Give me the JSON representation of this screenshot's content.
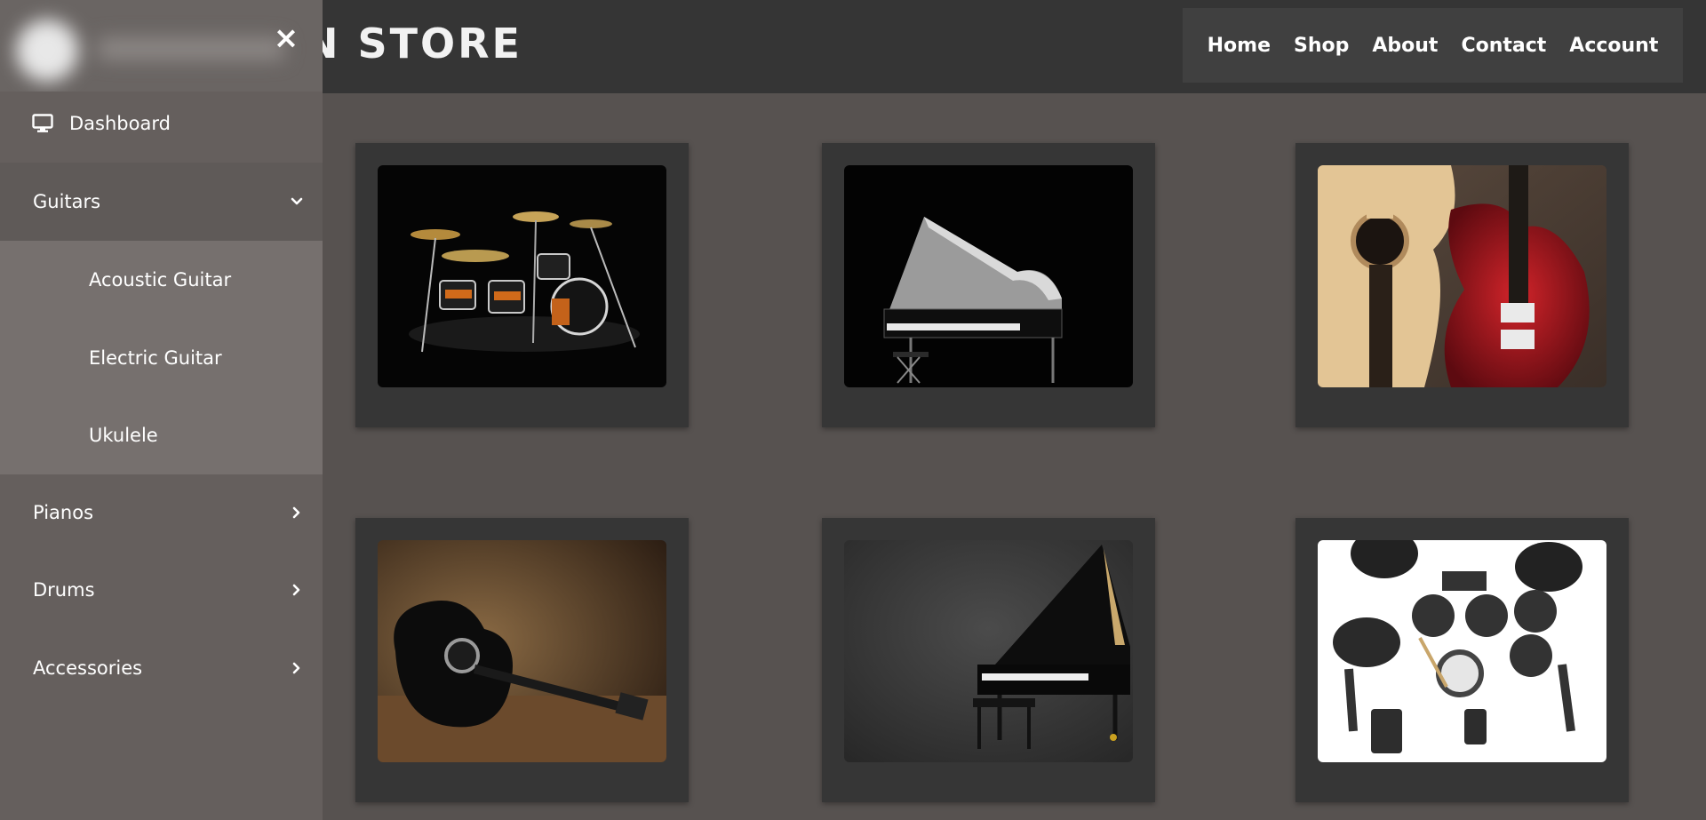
{
  "header": {
    "brand": "N STORE",
    "nav": [
      "Home",
      "Shop",
      "About",
      "Contact",
      "Account"
    ]
  },
  "sidebar": {
    "close_label": "×",
    "items": [
      {
        "label": "Dashboard",
        "icon": "monitor-icon"
      },
      {
        "label": "Guitars",
        "icon": "chevron-down-icon",
        "expanded": true
      },
      {
        "label": "Pianos",
        "icon": "chevron-right-icon"
      },
      {
        "label": "Drums",
        "icon": "chevron-right-icon"
      },
      {
        "label": "Accessories",
        "icon": "chevron-right-icon"
      }
    ],
    "guitars_sub": [
      "Acoustic Guitar",
      "Electric Guitar",
      "Ukulele"
    ]
  },
  "products": [
    {
      "image": "drum-kit-image"
    },
    {
      "image": "grand-piano-image"
    },
    {
      "image": "guitars-image"
    },
    {
      "image": "acoustic-guitar-image"
    },
    {
      "image": "piano-image"
    },
    {
      "image": "electronic-drums-image"
    }
  ],
  "colors": {
    "background": "#575250",
    "header": "#353535",
    "nav_box": "#404040",
    "card": "#363636",
    "sidebar": "#655f5d",
    "sidebar_sub": "#76706e"
  }
}
